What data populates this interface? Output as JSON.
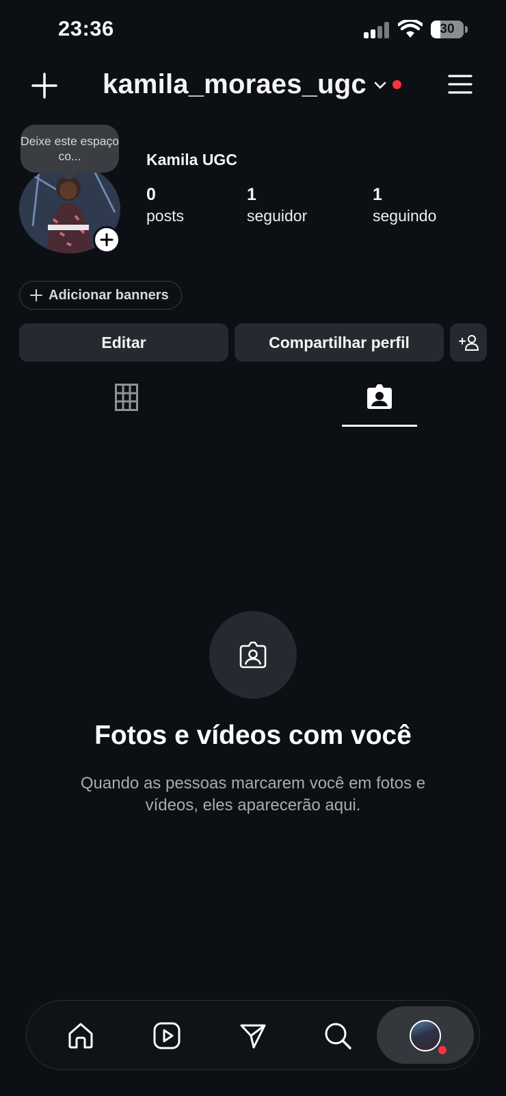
{
  "status_bar": {
    "time": "23:36",
    "battery_percent": "30",
    "icons": [
      "cellular-signal-icon",
      "wifi-icon",
      "battery-icon"
    ]
  },
  "header": {
    "username": "kamila_moraes_ugc",
    "icons": [
      "plus-icon",
      "chevron-down-icon",
      "hamburger-menu-icon"
    ],
    "notification_dot_color": "#ff3040"
  },
  "profile": {
    "note_text": "Deixe este espaço co...",
    "display_name": "Kamila UGC",
    "stats": [
      {
        "value": "0",
        "label": "posts"
      },
      {
        "value": "1",
        "label": "seguidor"
      },
      {
        "value": "1",
        "label": "seguindo"
      }
    ]
  },
  "actions": {
    "banner_label": "Adicionar banners",
    "edit_label": "Editar",
    "share_label": "Compartilhar perfil"
  },
  "tabs": [
    {
      "icon": "grid-icon",
      "active": false
    },
    {
      "icon": "tagged-person-icon",
      "active": true
    }
  ],
  "empty_state": {
    "icon": "tagged-person-icon",
    "title": "Fotos e vídeos com você",
    "subtitle": "Quando as pessoas marcarem você em fotos e vídeos, eles aparecerão aqui."
  },
  "bottom_nav": {
    "items": [
      "home-icon",
      "reels-icon",
      "send-icon",
      "search-icon",
      "profile-avatar"
    ]
  },
  "colors": {
    "background": "#0c0f14",
    "button": "#26292f",
    "accent_red": "#ff3040"
  }
}
